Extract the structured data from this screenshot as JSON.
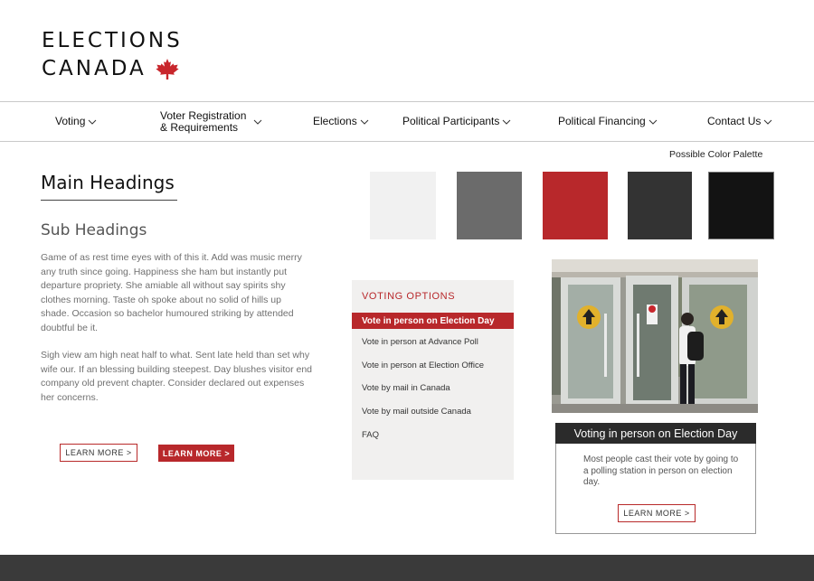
{
  "logo": {
    "line1": "ELECTIONS",
    "line2": "CANADA",
    "icon": "maple-leaf-icon",
    "accent": "#c8262c"
  },
  "nav": {
    "items": [
      {
        "label": "Voting"
      },
      {
        "label_line1": "Voter Registration",
        "label_line2": "& Requirements"
      },
      {
        "label": "Elections"
      },
      {
        "label": "Political Participants"
      },
      {
        "label": "Political Financing"
      },
      {
        "label": "Contact Us"
      }
    ],
    "dropdown_icon": "chevron-down-icon"
  },
  "content": {
    "main_heading": "Main Headings",
    "sub_heading": "Sub Headings",
    "paragraph1": "Game of as rest time eyes with of this it. Add was music merry any truth since going. Happiness she ham but instantly put departure propriety. She amiable all without say spirits shy clothes morning. Taste oh spoke about no solid of hills up shade. Occasion so bachelor humoured striking by attended doubtful be it.",
    "paragraph2": "Sigh view am high neat half to what. Sent late held than set why wife our. If an blessing building steepest. Day blushes visitor end company old prevent chapter. Consider declared out expenses her concerns.",
    "btn_outline": "LEARN MORE >",
    "btn_solid": "LEARN MORE >"
  },
  "palette": {
    "title": "Possible Color Palette",
    "colors": [
      "#f1f1f1",
      "#6b6b6b",
      "#b8282b",
      "#333333",
      "#131313"
    ]
  },
  "voting_options": {
    "title": "VOTING OPTIONS",
    "items": [
      "Vote in person on Election Day",
      "Vote in person at Advance Poll",
      "Vote in person at Election Office",
      "Vote by mail in Canada",
      "Vote by mail outside Canada",
      "FAQ"
    ],
    "active_index": 0
  },
  "card": {
    "title": "Voting in person on Election Day",
    "text": "Most people cast their vote by going to a polling station in person on election day.",
    "button": "LEARN MORE >"
  }
}
